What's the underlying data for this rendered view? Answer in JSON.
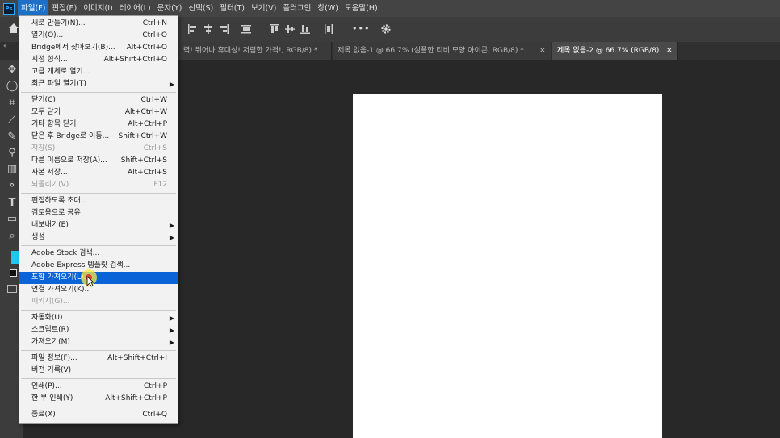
{
  "menubar": {
    "logo": "Ps",
    "items": [
      "파일(F)",
      "편집(E)",
      "이미지(I)",
      "레이어(L)",
      "문자(Y)",
      "선택(S)",
      "필터(T)",
      "보기(V)",
      "플러그인",
      "창(W)",
      "도움말(H)"
    ]
  },
  "tabs": [
    {
      "label": "력! 뛰어나 휴대성! 저렴한 가격!, RGB/8) *",
      "active": false
    },
    {
      "label": "제목 없음-1 @ 66.7% (심플한 티비 모양 아이콘, RGB/8) *",
      "active": false
    },
    {
      "label": "제목 없음-2 @ 66.7% (RGB/8)",
      "active": true
    }
  ],
  "tab_close": "×",
  "optbar": {
    "more": "•••"
  },
  "file_menu": {
    "groups": [
      [
        {
          "label": "새로 만들기(N)...",
          "shortcut": "Ctrl+N"
        },
        {
          "label": "열기(O)...",
          "shortcut": "Ctrl+O"
        },
        {
          "label": "Bridge에서 찾아보기(B)...",
          "shortcut": "Alt+Ctrl+O"
        },
        {
          "label": "지정 형식...",
          "shortcut": "Alt+Shift+Ctrl+O"
        },
        {
          "label": "고급 개체로 열기...",
          "shortcut": ""
        },
        {
          "label": "최근 파일 열기(T)",
          "shortcut": "",
          "submenu": true
        }
      ],
      [
        {
          "label": "닫기(C)",
          "shortcut": "Ctrl+W"
        },
        {
          "label": "모두 닫기",
          "shortcut": "Alt+Ctrl+W"
        },
        {
          "label": "기타 항목 닫기",
          "shortcut": "Alt+Ctrl+P"
        },
        {
          "label": "닫은 후 Bridge로 이동...",
          "shortcut": "Shift+Ctrl+W"
        },
        {
          "label": "저장(S)",
          "shortcut": "Ctrl+S",
          "disabled": true
        },
        {
          "label": "다른 이름으로 저장(A)...",
          "shortcut": "Shift+Ctrl+S"
        },
        {
          "label": "사본 저장...",
          "shortcut": "Alt+Ctrl+S"
        },
        {
          "label": "되돌리기(V)",
          "shortcut": "F12",
          "disabled": true
        }
      ],
      [
        {
          "label": "편집하도록 초대...",
          "shortcut": ""
        },
        {
          "label": "검토용으로 공유",
          "shortcut": ""
        },
        {
          "label": "내보내기(E)",
          "shortcut": "",
          "submenu": true
        },
        {
          "label": "생성",
          "shortcut": "",
          "submenu": true
        }
      ],
      [
        {
          "label": "Adobe Stock 검색...",
          "shortcut": ""
        },
        {
          "label": "Adobe Express 템플릿 검색...",
          "shortcut": ""
        },
        {
          "label": "포함 가져오기(L)...",
          "shortcut": "",
          "highlighted": true
        },
        {
          "label": "연결 가져오기(K)...",
          "shortcut": ""
        },
        {
          "label": "패키지(G)...",
          "shortcut": "",
          "disabled": true
        }
      ],
      [
        {
          "label": "자동화(U)",
          "shortcut": "",
          "submenu": true
        },
        {
          "label": "스크립트(R)",
          "shortcut": "",
          "submenu": true
        },
        {
          "label": "가져오기(M)",
          "shortcut": "",
          "submenu": true
        }
      ],
      [
        {
          "label": "파일 정보(F)...",
          "shortcut": "Alt+Shift+Ctrl+I"
        },
        {
          "label": "버전 기록(V)",
          "shortcut": ""
        }
      ],
      [
        {
          "label": "인쇄(P)...",
          "shortcut": "Ctrl+P"
        },
        {
          "label": "한 부 인쇄(Y)",
          "shortcut": "Alt+Shift+Ctrl+P"
        }
      ],
      [
        {
          "label": "종료(X)",
          "shortcut": "Ctrl+Q"
        }
      ]
    ]
  },
  "colors": {
    "accent": "#0a64d8",
    "foreground_swatch": "#1ec8f0",
    "canvas": "#ffffff",
    "workspace": "#282828"
  }
}
